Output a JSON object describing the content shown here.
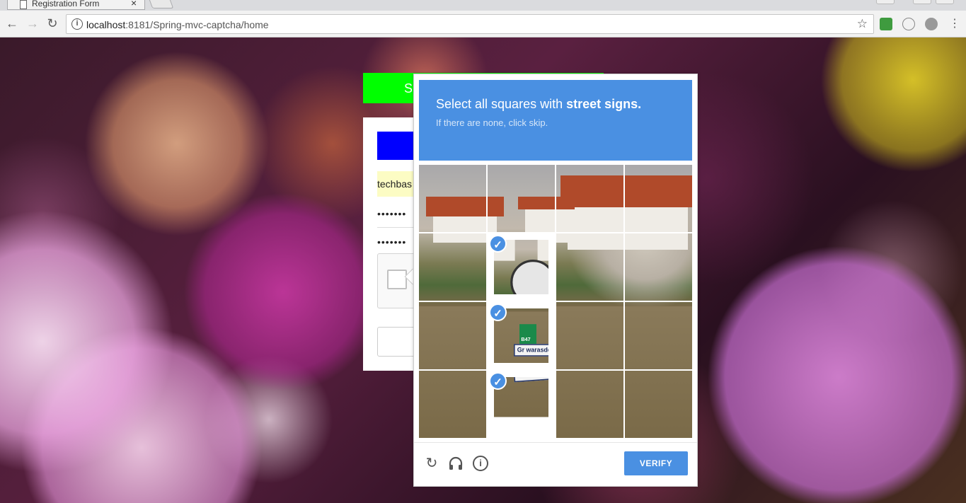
{
  "browser": {
    "tab_title": "Registration Form",
    "tab_close": "×",
    "url_host": "localhost",
    "url_rest": ":8181/Spring-mvc-captcha/home"
  },
  "form": {
    "header_label": "S",
    "username_value": "techbas",
    "password_mask": "•••••••",
    "confirm_mask": "•••••••"
  },
  "captcha": {
    "instruction_lead": "Select all squares with ",
    "instruction_keyword": "street signs",
    "instruction_end": ".",
    "sub_instruction": "If there are none, click skip.",
    "verify_label": "VERIFY",
    "selected_tiles": [
      5,
      9,
      13
    ],
    "sign_text_1": "Gr warasdorf",
    "sign_text_2": "B47",
    "sign_text_3": "Veliki Boristof"
  },
  "colors": {
    "captcha_blue": "#4a90e2",
    "form_header_green": "#00ff00",
    "form_blue_bar": "#0000ff"
  }
}
